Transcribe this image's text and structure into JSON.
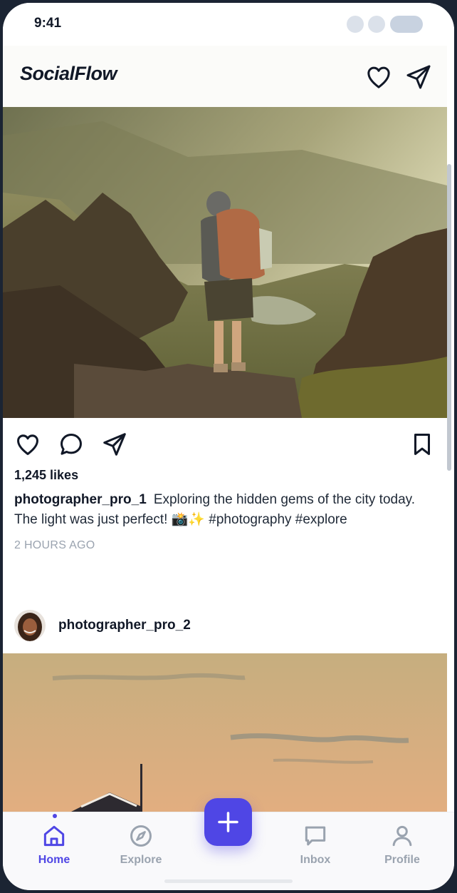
{
  "status_bar": {
    "time": "9:41"
  },
  "header": {
    "brand": "SocialFlow",
    "icons": [
      "heart-icon",
      "send-icon"
    ]
  },
  "post1": {
    "likes": "1,245 likes",
    "username": "photographer_pro_1",
    "caption": "Exploring the hidden gems of the city today. The light was just perfect! 📸✨ #photography #explore",
    "time_ago": "2 HOURS AGO",
    "actions": [
      "heart-icon",
      "comment-icon",
      "send-icon",
      "bookmark-icon"
    ]
  },
  "post2": {
    "username": "photographer_pro_2"
  },
  "tabbar": {
    "tabs": [
      {
        "label": "Home",
        "icon": "home-icon",
        "active": true
      },
      {
        "label": "Explore",
        "icon": "compass-icon",
        "active": false
      },
      {
        "label": "Inbox",
        "icon": "chat-icon",
        "active": false
      },
      {
        "label": "Profile",
        "icon": "user-icon",
        "active": false
      }
    ],
    "fab_icon": "plus-icon"
  },
  "colors": {
    "accent": "#4f46e5",
    "text": "#111827",
    "muted": "#9aa3af"
  }
}
